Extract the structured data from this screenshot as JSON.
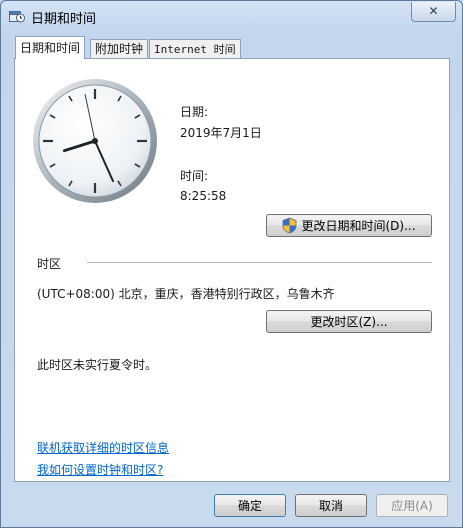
{
  "window": {
    "title": "日期和时间",
    "close_symbol": "✕"
  },
  "tabs": [
    {
      "label": "日期和时间",
      "active": true
    },
    {
      "label": "附加时钟",
      "active": false
    },
    {
      "label": "Internet 时间",
      "active": false
    }
  ],
  "clock": {
    "hour": 8,
    "minute": 25,
    "second": 58
  },
  "date": {
    "label": "日期:",
    "value": "2019年7月1日"
  },
  "time": {
    "label": "时间:",
    "value": "8:25:58"
  },
  "change_datetime_button": "更改日期和时间(D)...",
  "timezone": {
    "section_label": "时区",
    "value": "(UTC+08:00) 北京，重庆，香港特别行政区，乌鲁木齐",
    "change_button": "更改时区(Z)...",
    "dst_note": "此时区未实行夏令时。"
  },
  "links": {
    "online_info": "联机获取详细的时区信息",
    "how_to_set": "我如何设置时钟和时区?"
  },
  "footer": {
    "ok": "确定",
    "cancel": "取消",
    "apply": "应用(A)"
  },
  "colors": {
    "link": "#0066cc",
    "titlebar": "#c3d6ee"
  }
}
